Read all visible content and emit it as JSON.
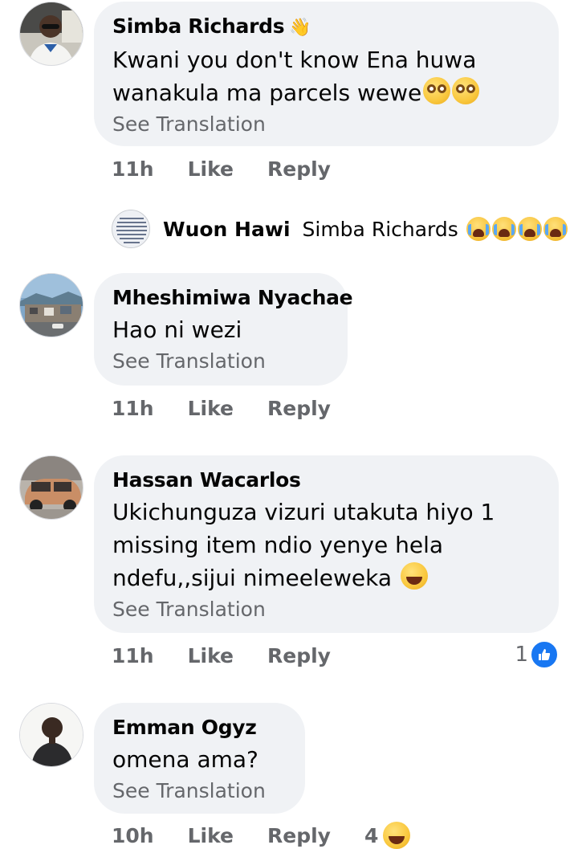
{
  "comments": [
    {
      "author": "Simba Richards",
      "author_badge": "👋",
      "text": "Kwani you don't know Ena huwa wanakula ma parcels wewe",
      "emoji_trailing": [
        "flushed-face",
        "flushed-face"
      ],
      "translate": "See Translation",
      "time": "11h",
      "like": "Like",
      "reply": "Reply"
    },
    {
      "author": "Mheshimiwa Nyachae",
      "text": "Hao ni wezi",
      "translate": "See Translation",
      "time": "11h",
      "like": "Like",
      "reply": "Reply"
    },
    {
      "author": "Hassan Wacarlos",
      "text": "Ukichunguza vizuri utakuta hiyo 1 missing item ndio yenye hela ndefu,,sijui nimeeleweka",
      "emoji_trailing": [
        "grinning-squinting-face"
      ],
      "translate": "See Translation",
      "time": "11h",
      "like": "Like",
      "reply": "Reply",
      "reaction_count": "1",
      "reaction_icon": "like-icon"
    },
    {
      "author": "Emman Ogyz",
      "text": "omena ama?",
      "translate": "See Translation",
      "time": "10h",
      "like": "Like",
      "reply": "Reply",
      "reaction_count": "4",
      "reaction_icon": "haha-icon"
    }
  ],
  "reply_preview": {
    "author": "Wuon Hawi",
    "mention": "Simba Richards",
    "emoji": [
      "crying-face",
      "crying-face",
      "crying-face",
      "crying-face"
    ]
  },
  "colors": {
    "bubble": "#f0f2f5",
    "secondary_text": "#65676b",
    "like_blue": "#1877f2"
  }
}
